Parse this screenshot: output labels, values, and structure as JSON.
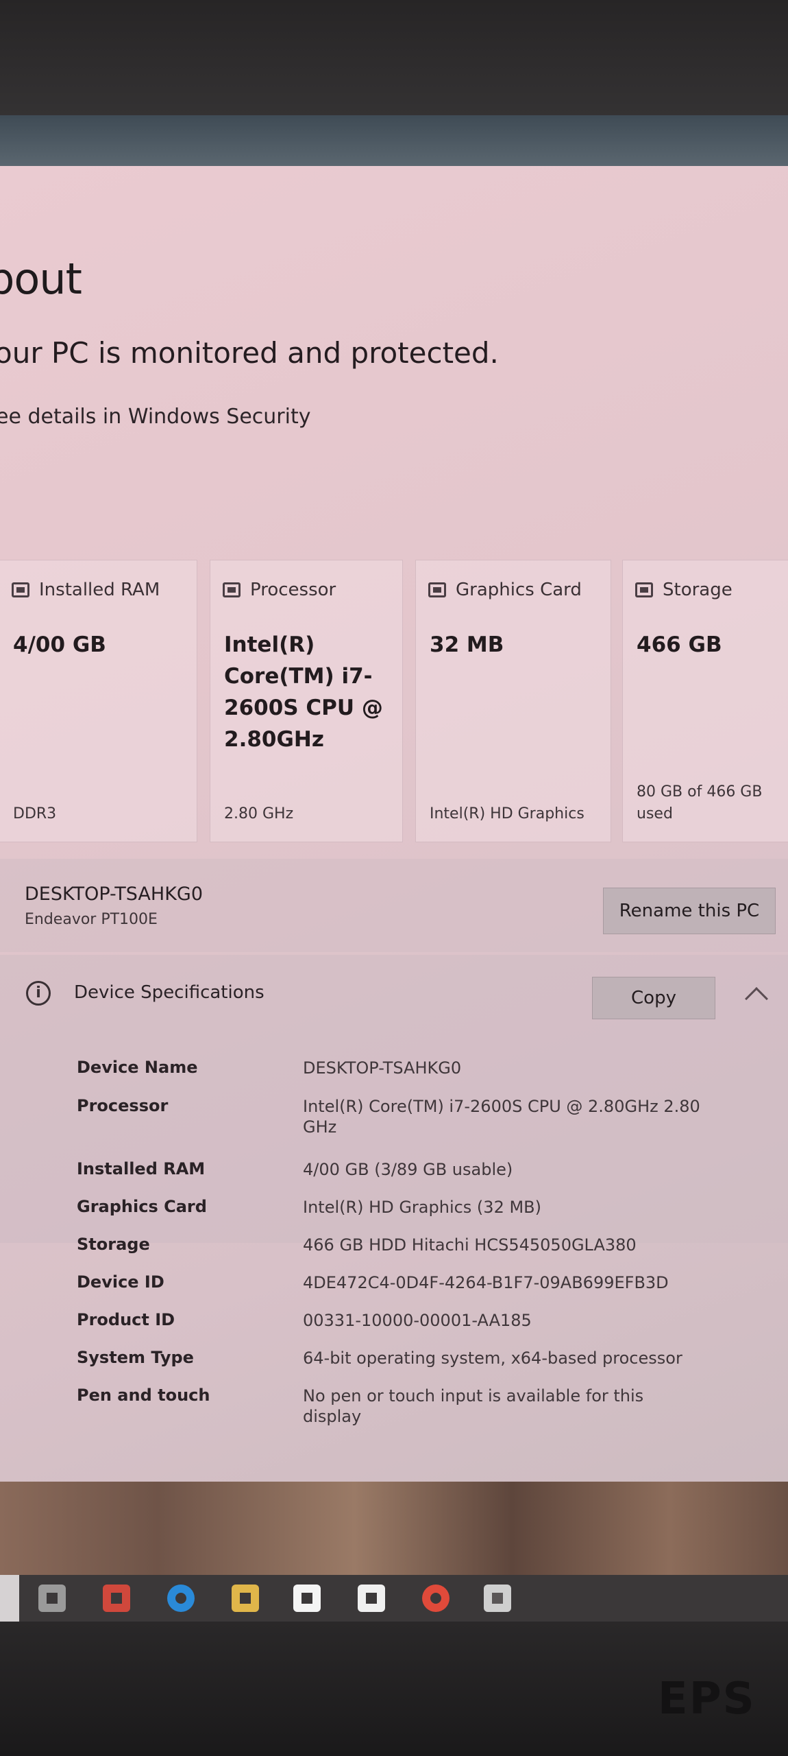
{
  "page": {
    "heading": "bout",
    "subheading": "our PC is monitored and protected.",
    "security_link": "ee details in Windows Security"
  },
  "cards": [
    {
      "title": "Installed RAM",
      "icon": "ram-icon",
      "value": "4/00 GB",
      "foot": "DDR3"
    },
    {
      "title": "Processor",
      "icon": "processor-icon",
      "value": "Intel(R) Core(TM) i7-2600S CPU @ 2.80GHz",
      "foot": "2.80 GHz"
    },
    {
      "title": "Graphics Card",
      "icon": "graphics-card-icon",
      "value": "32 MB",
      "foot": "Intel(R) HD Graphics"
    },
    {
      "title": "Storage",
      "icon": "storage-icon",
      "value": "466 GB",
      "foot": "80 GB of 466 GB used"
    }
  ],
  "pc": {
    "name": "DESKTOP-TSAHKG0",
    "model": "Endeavor PT100E",
    "rename_label": "Rename this PC"
  },
  "specs": {
    "title": "Device Specifications",
    "copy_label": "Copy",
    "rows": [
      {
        "key": "Device Name",
        "value": "DESKTOP-TSAHKG0"
      },
      {
        "key": "Processor",
        "value": "Intel(R) Core(TM) i7-2600S CPU @ 2.80GHz 2.80 GHz"
      },
      {
        "key": "Installed RAM",
        "value": "4/00 GB (3/89 GB usable)"
      },
      {
        "key": "Graphics Card",
        "value": "Intel(R) HD Graphics (32 MB)"
      },
      {
        "key": "Storage",
        "value": "466 GB HDD Hitachi HCS545050GLA380"
      },
      {
        "key": "Device ID",
        "value": "4DE472C4-0D4F-4264-B1F7-09AB699EFB3D"
      },
      {
        "key": "Product ID",
        "value": "00331-10000-00001-AA185"
      },
      {
        "key": "System Type",
        "value": "64-bit operating system, x64-based processor"
      },
      {
        "key": "Pen and touch",
        "value": "No pen or touch input is available for this display"
      }
    ]
  },
  "taskbar": {
    "icons": [
      "task-view-icon",
      "app-icon",
      "edge-icon",
      "file-explorer-icon",
      "store-icon",
      "mail-icon",
      "chrome-icon",
      "settings-icon"
    ],
    "colors": [
      "#9a9a9a",
      "#d0483c",
      "#2a8ad8",
      "#e0b64a",
      "#f4f4f4",
      "#f0f0f0",
      "#e04a3a",
      "#cfcfcf"
    ]
  },
  "monitor": {
    "brand": "EPS"
  }
}
